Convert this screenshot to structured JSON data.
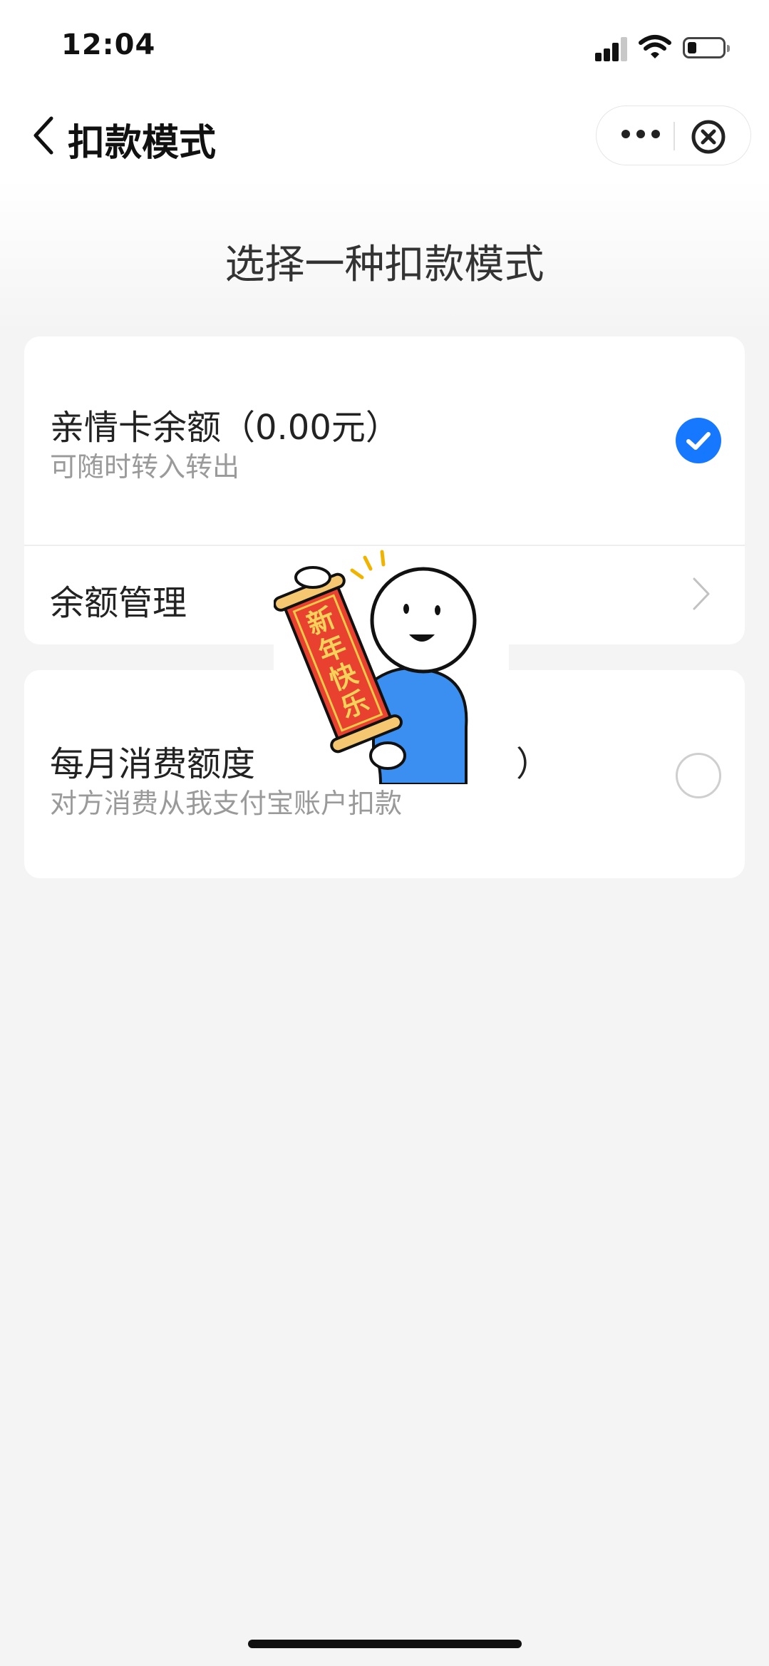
{
  "status_bar": {
    "time": "12:04"
  },
  "nav": {
    "title": "扣款模式"
  },
  "subtitle": "选择一种扣款模式",
  "option1": {
    "title": "亲情卡余额（0.00元）",
    "subtitle": "可随时转入转出",
    "selected": true
  },
  "balance_manage": {
    "label": "余额管理"
  },
  "option2": {
    "title": "每月消费额度",
    "title_suffix": "）",
    "subtitle": "对方消费从我支付宝账户扣款",
    "selected": false
  },
  "sticker": {
    "text_chars": [
      "新",
      "年",
      "快",
      "乐"
    ]
  },
  "colors": {
    "accent": "#1677ff",
    "background": "#f4f4f4",
    "sticker_red": "#e8412f",
    "sticker_blue": "#3b8ff0"
  }
}
